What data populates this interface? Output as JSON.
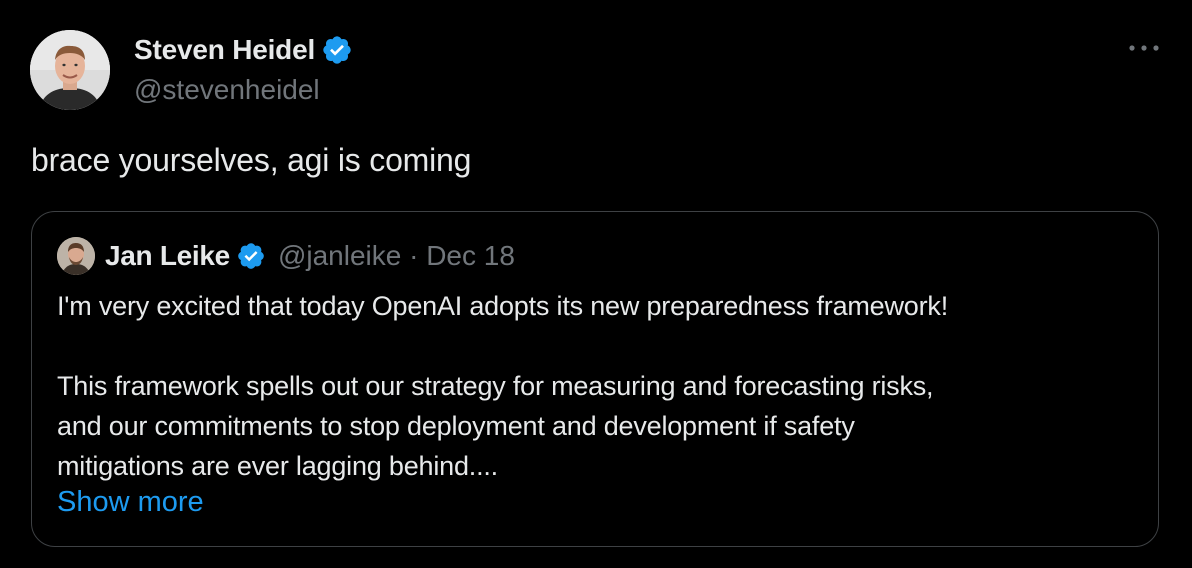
{
  "author": {
    "display_name": "Steven Heidel",
    "handle": "@stevenheidel",
    "verified": true
  },
  "tweet": {
    "text": "brace yourselves, agi is coming"
  },
  "quoted_tweet": {
    "display_name": "Jan Leike",
    "verified": true,
    "meta": "@janleike · Dec 18",
    "paragraph_1": "I'm very excited that today OpenAI adopts its new preparedness framework!",
    "paragraph_2_line_1": "This framework spells out our strategy for measuring and forecasting risks,",
    "paragraph_2_line_2": "and our commitments to stop deployment and development if safety",
    "paragraph_2_line_3": "mitigations are ever lagging behind....",
    "show_more_label": "Show more"
  },
  "icons": {
    "verified": "verified-badge-icon",
    "more": "more-horizontal-icon"
  },
  "colors": {
    "background": "#000000",
    "primary_text": "#e7e9ea",
    "secondary_text": "#71767b",
    "link": "#1d9bf0",
    "verified_badge": "#1d9bf0",
    "quote_border": "#3e4144"
  }
}
